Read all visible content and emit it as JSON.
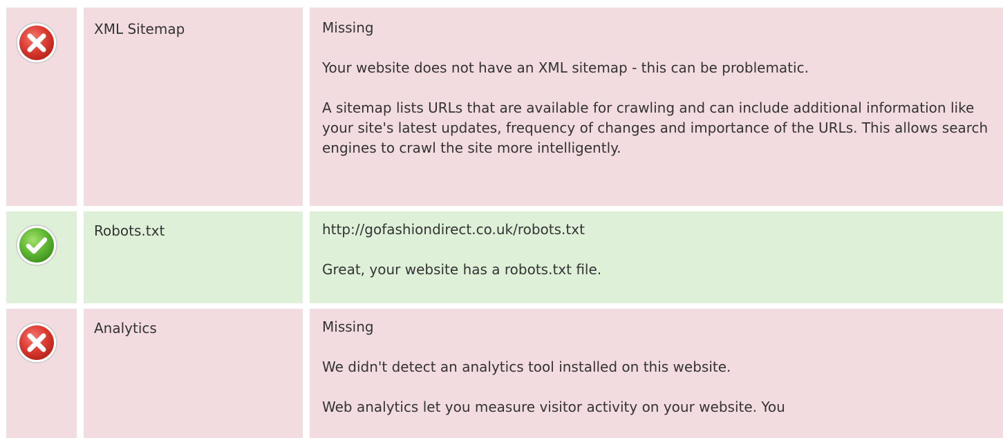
{
  "colors": {
    "fail_background": "#f2dcdf",
    "pass_background": "#dff0d9",
    "fail_icon": "#d9342b",
    "pass_icon": "#5fb833",
    "text": "#333333"
  },
  "checks": [
    {
      "status": "fail",
      "icon": "error-x-icon",
      "name": "XML Sitemap",
      "value": "Missing",
      "paragraphs": [
        "Your website does not have an XML sitemap - this can be problematic.",
        "A sitemap lists URLs that are available for crawling and can include additional information like your site's latest updates, frequency of changes and importance of the URLs. This allows search engines to crawl the site more intelligently."
      ]
    },
    {
      "status": "pass",
      "icon": "success-check-icon",
      "name": "Robots.txt",
      "value": "http://gofashiondirect.co.uk/robots.txt",
      "paragraphs": [
        "Great, your website has a robots.txt file."
      ]
    },
    {
      "status": "fail",
      "icon": "error-x-icon",
      "name": "Analytics",
      "value": "Missing",
      "paragraphs": [
        "We didn't detect an analytics tool installed on this website.",
        "Web analytics let you measure visitor activity on your website. You"
      ]
    }
  ]
}
